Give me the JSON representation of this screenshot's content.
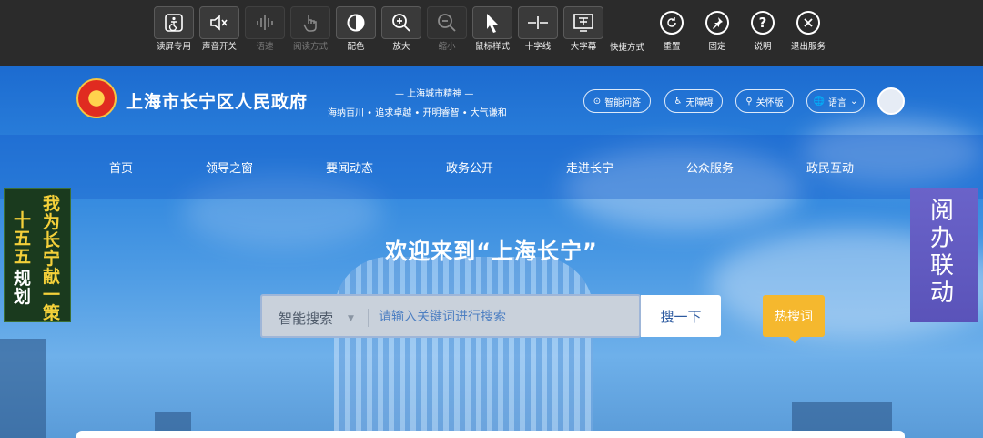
{
  "toolbar": {
    "items": [
      {
        "label": "读屏专用",
        "icon": "accessible-icon"
      },
      {
        "label": "声音开关",
        "icon": "speaker-mute-icon"
      },
      {
        "label": "语速",
        "icon": "waveform-icon",
        "disabled": true
      },
      {
        "label": "阅读方式",
        "icon": "hand-pointer-icon",
        "disabled": true
      },
      {
        "label": "配色",
        "icon": "contrast-icon"
      },
      {
        "label": "放大",
        "icon": "zoom-in-icon"
      },
      {
        "label": "缩小",
        "icon": "zoom-out-icon",
        "disabled": true
      },
      {
        "label": "鼠标样式",
        "icon": "cursor-icon"
      },
      {
        "label": "十字线",
        "icon": "crosshair-icon"
      },
      {
        "label": "大字幕",
        "icon": "caption-icon"
      },
      {
        "label": "快捷方式"
      },
      {
        "label": "重置",
        "icon": "reset-icon"
      },
      {
        "label": "固定",
        "icon": "pin-icon"
      },
      {
        "label": "说明",
        "icon": "help-icon"
      },
      {
        "label": "退出服务",
        "icon": "close-icon"
      }
    ]
  },
  "header": {
    "site_title": "上海市长宁区人民政府",
    "spirit_title": "— 上海城市精神 —",
    "spirit_items": "海纳百川  •  追求卓越  •  开明睿智  •  大气谦和",
    "buttons": {
      "ai_qa": "智能问答",
      "accessibility": "无障碍",
      "care": "关怀版",
      "language": "语言"
    }
  },
  "nav": {
    "items": [
      "首页",
      "领导之窗",
      "要闻动态",
      "政务公开",
      "走进长宁",
      "公众服务",
      "政民互动"
    ]
  },
  "left_banner": {
    "col1": "十五五",
    "col2": "规划",
    "col3": "我为长宁献一策"
  },
  "right_banner": {
    "text": "阅办联动"
  },
  "hero": {
    "welcome": "欢迎来到“上海长宁”"
  },
  "search": {
    "type_label": "智能搜索",
    "placeholder": "请输入关键词进行搜索",
    "button_label": "搜一下",
    "hot_label": "热搜词"
  },
  "colors": {
    "toolbar_bg": "#2b2b2b",
    "hot_button": "#f5b82e",
    "right_banner": "#6a63c9"
  }
}
